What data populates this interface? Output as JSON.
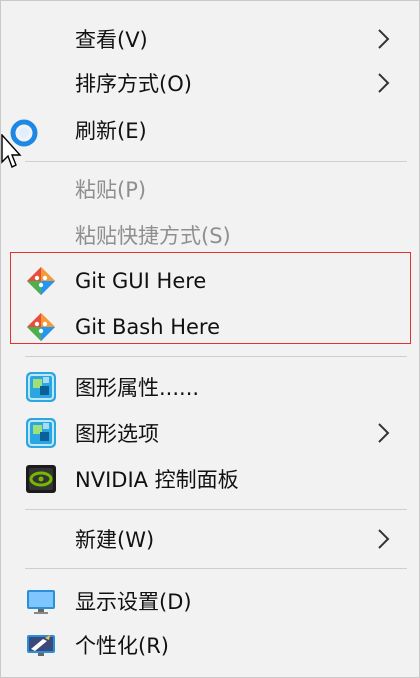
{
  "menu": {
    "items": [
      {
        "label": "查看(V)",
        "submenu": true
      },
      {
        "label": "排序方式(O)",
        "submenu": true
      },
      {
        "label": "刷新(E)",
        "submenu": false
      },
      {
        "label": "粘贴(P)",
        "submenu": false,
        "disabled": true
      },
      {
        "label": "粘贴快捷方式(S)",
        "submenu": false,
        "disabled": true
      },
      {
        "label": "Git GUI Here",
        "icon": "git-gui-icon"
      },
      {
        "label": "Git Bash Here",
        "icon": "git-bash-icon"
      },
      {
        "label": "图形属性......",
        "icon": "intel-graphics-icon"
      },
      {
        "label": "图形选项",
        "icon": "intel-graphics-options-icon",
        "submenu": true
      },
      {
        "label": "NVIDIA 控制面板",
        "icon": "nvidia-icon"
      },
      {
        "label": "新建(W)",
        "submenu": true
      },
      {
        "label": "显示设置(D)",
        "icon": "display-settings-icon"
      },
      {
        "label": "个性化(R)",
        "icon": "personalize-icon"
      }
    ]
  },
  "colors": {
    "background": "#f2f2f2",
    "highlight_border": "#e0332f",
    "disabled_text": "#8f8f8f"
  }
}
